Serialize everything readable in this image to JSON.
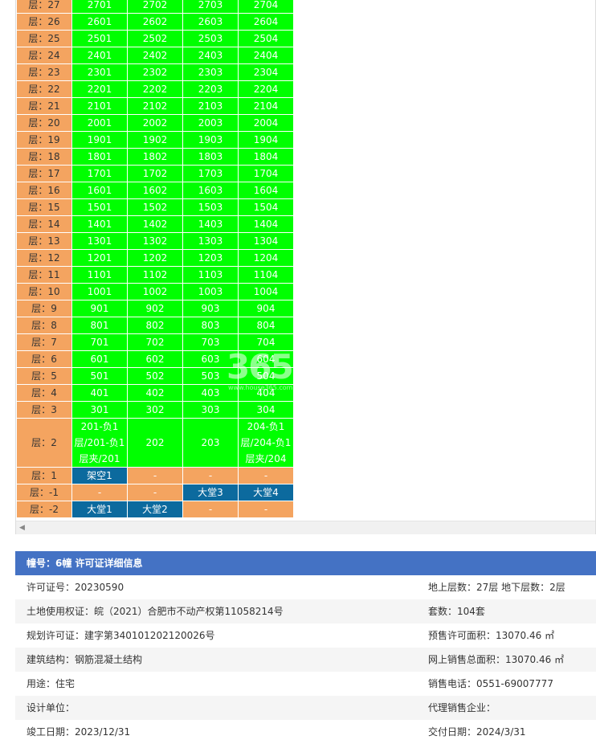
{
  "floor_prefix": "层：",
  "rows": [
    {
      "floor": "27",
      "units": [
        "2701",
        "2702",
        "2703",
        "2704"
      ]
    },
    {
      "floor": "26",
      "units": [
        "2601",
        "2602",
        "2603",
        "2604"
      ]
    },
    {
      "floor": "25",
      "units": [
        "2501",
        "2502",
        "2503",
        "2504"
      ]
    },
    {
      "floor": "24",
      "units": [
        "2401",
        "2402",
        "2403",
        "2404"
      ]
    },
    {
      "floor": "23",
      "units": [
        "2301",
        "2302",
        "2303",
        "2304"
      ]
    },
    {
      "floor": "22",
      "units": [
        "2201",
        "2202",
        "2203",
        "2204"
      ]
    },
    {
      "floor": "21",
      "units": [
        "2101",
        "2102",
        "2103",
        "2104"
      ]
    },
    {
      "floor": "20",
      "units": [
        "2001",
        "2002",
        "2003",
        "2004"
      ]
    },
    {
      "floor": "19",
      "units": [
        "1901",
        "1902",
        "1903",
        "1904"
      ]
    },
    {
      "floor": "18",
      "units": [
        "1801",
        "1802",
        "1803",
        "1804"
      ]
    },
    {
      "floor": "17",
      "units": [
        "1701",
        "1702",
        "1703",
        "1704"
      ]
    },
    {
      "floor": "16",
      "units": [
        "1601",
        "1602",
        "1603",
        "1604"
      ]
    },
    {
      "floor": "15",
      "units": [
        "1501",
        "1502",
        "1503",
        "1504"
      ]
    },
    {
      "floor": "14",
      "units": [
        "1401",
        "1402",
        "1403",
        "1404"
      ]
    },
    {
      "floor": "13",
      "units": [
        "1301",
        "1302",
        "1303",
        "1304"
      ]
    },
    {
      "floor": "12",
      "units": [
        "1201",
        "1202",
        "1203",
        "1204"
      ]
    },
    {
      "floor": "11",
      "units": [
        "1101",
        "1102",
        "1103",
        "1104"
      ]
    },
    {
      "floor": "10",
      "units": [
        "1001",
        "1002",
        "1003",
        "1004"
      ]
    },
    {
      "floor": "9",
      "units": [
        "901",
        "902",
        "903",
        "904"
      ]
    },
    {
      "floor": "8",
      "units": [
        "801",
        "802",
        "803",
        "804"
      ]
    },
    {
      "floor": "7",
      "units": [
        "701",
        "702",
        "703",
        "704"
      ]
    },
    {
      "floor": "6",
      "units": [
        "601",
        "602",
        "603",
        "604"
      ]
    },
    {
      "floor": "5",
      "units": [
        "501",
        "502",
        "503",
        "504"
      ]
    },
    {
      "floor": "4",
      "units": [
        "401",
        "402",
        "403",
        "404"
      ]
    },
    {
      "floor": "3",
      "units": [
        "301",
        "302",
        "303",
        "304"
      ]
    }
  ],
  "floor2": {
    "floor": "2",
    "u1": [
      "201-负1",
      "层/201-负1",
      "层夹/201"
    ],
    "u2": "202",
    "u3": "203",
    "u4": [
      "204-负1",
      "层/204-负1",
      "层夹/204"
    ]
  },
  "floor1": {
    "floor": "1",
    "u1": "架空1",
    "u2": "-",
    "u3": "-",
    "u4": "-"
  },
  "floor_m1": {
    "floor": "-1",
    "u1": "-",
    "u2": "-",
    "u3": "大堂3",
    "u4": "大堂4"
  },
  "floor_m2": {
    "floor": "-2",
    "u1": "大堂1",
    "u2": "大堂2",
    "u3": "-",
    "u4": "-"
  },
  "watermark": {
    "main": "365",
    "sub": "www.house365.com"
  },
  "colors": {
    "available": "#00ff00",
    "label": "#f4a460",
    "lobby": "#0c6a9e",
    "header": "#4472c4"
  },
  "info": {
    "header": "幢号：6幢 许可证详细信息",
    "permit_no": "许可证号：20230590",
    "floors": "地上层数：27层  地下层数：2层",
    "land": "土地使用权证：皖（2021）合肥市不动产权第11058214号",
    "units_count": "套数：104套",
    "planning": "规划许可证：建字第340101202120026号",
    "presale_area": "预售许可面积：13070.46 ㎡",
    "structure": "建筑结构：钢筋混凝土结构",
    "online_area": "网上销售总面积：13070.46 ㎡",
    "usage": "用途：住宅",
    "sales_phone": "销售电话：0551-69007777",
    "design": "设计单位：",
    "agent": "代理销售企业：",
    "completion": "竣工日期：2023/12/31",
    "delivery": "交付日期：2024/3/31"
  }
}
